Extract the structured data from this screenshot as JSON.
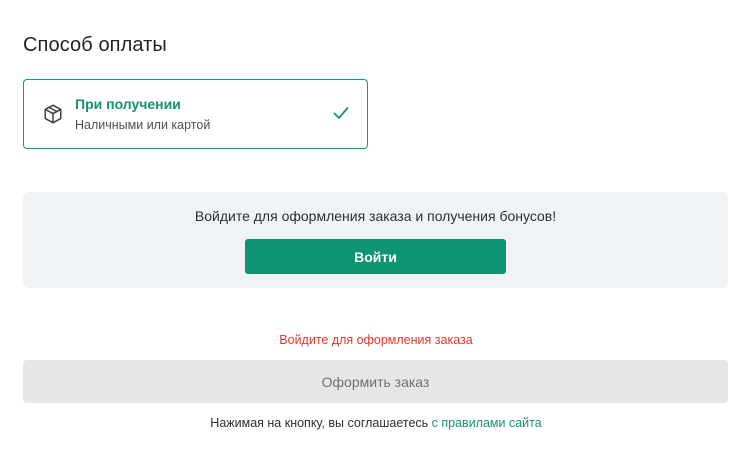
{
  "payment": {
    "section_title": "Способ оплаты",
    "option": {
      "title": "При получении",
      "subtitle": "Наличными или картой",
      "icon": "package-box-icon",
      "selected_icon": "check-icon",
      "selected": true
    }
  },
  "login_panel": {
    "text": "Войдите для оформления заказа и получения бонусов!",
    "button_label": "Войти"
  },
  "order": {
    "warning": "Войдите для оформления заказа",
    "submit_label": "Оформить заказ",
    "agreement_prefix": "Нажимая на кнопку, вы соглашаетесь ",
    "agreement_link": "с правилами сайта"
  },
  "colors": {
    "accent": "#0d9470",
    "warning": "#e8352e",
    "panel_bg": "#f0f3f6",
    "disabled_bg": "#e6e6e6"
  }
}
